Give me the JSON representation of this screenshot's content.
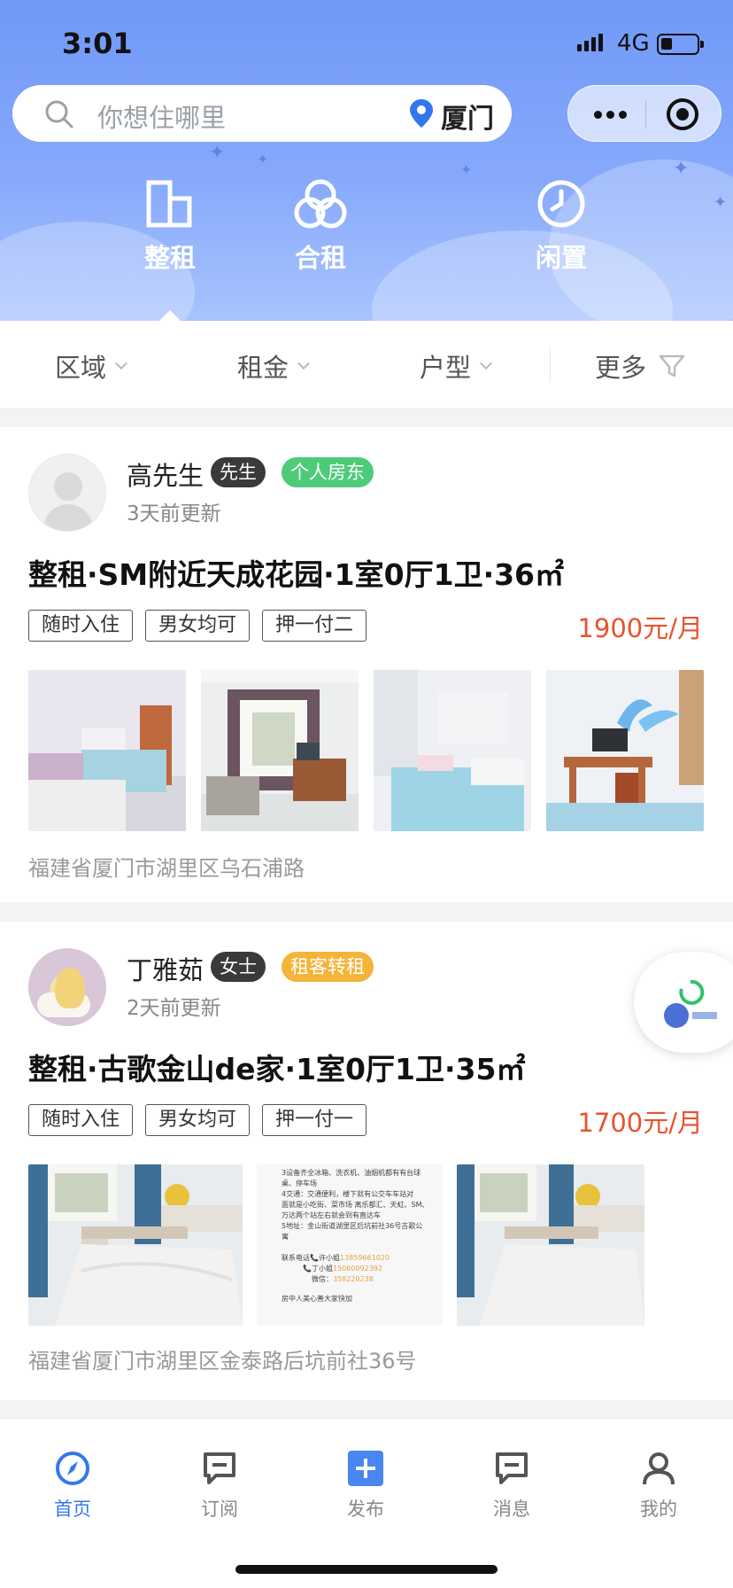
{
  "status": {
    "time": "3:01",
    "network": "4G"
  },
  "search": {
    "placeholder": "你想住哪里",
    "city": "厦门"
  },
  "categories": [
    {
      "label": "整租",
      "icon": "building-icon"
    },
    {
      "label": "合租",
      "icon": "circles-icon"
    },
    {
      "label": "闲置",
      "icon": "clock-icon"
    }
  ],
  "filters": [
    {
      "label": "区域"
    },
    {
      "label": "租金"
    },
    {
      "label": "户型"
    },
    {
      "label": "更多"
    }
  ],
  "listings": [
    {
      "owner": "高先生",
      "gender": "先生",
      "role": "个人房东",
      "updated": "3天前更新",
      "title": "整租·SM附近天成花园·1室0厅1卫·36㎡",
      "tags": [
        "随时入住",
        "男女均可",
        "押一付二"
      ],
      "price": "1900元/月",
      "address": "福建省厦门市湖里区乌石浦路"
    },
    {
      "owner": "丁雅茹",
      "gender": "女士",
      "role": "租客转租",
      "updated": "2天前更新",
      "title": "整租·古歌金山de家·1室0厅1卫·35㎡",
      "tags": [
        "随时入住",
        "男女均可",
        "押一付一"
      ],
      "price": "1700元/月",
      "address": "福建省厦门市湖里区金泰路后坑前社36号",
      "notice": {
        "lines": [
          "3设备齐全冰箱、洗衣机、油烟机都有有台球",
          "桌、停车场",
          "4交通：交通便利，楼下就有公交车车站对",
          "面就是小吃街、菜市场 离乐都汇、天虹、SM、",
          "万达两个站左右就会到有直达车",
          "5地址：金山街道湖里区后坑前社36号古歌公",
          "寓"
        ],
        "contact_label": "联系电话",
        "contacts": [
          {
            "name": "许小姐",
            "phone": "13859661020"
          },
          {
            "name": "丁小姐",
            "phone": "15060092392"
          }
        ],
        "wechat_label": "微信：",
        "wechat": "358220238",
        "footer": "房中人美心善大家快加"
      }
    }
  ],
  "tabbar": [
    {
      "label": "首页",
      "active": true
    },
    {
      "label": "订阅",
      "active": false
    },
    {
      "label": "发布",
      "active": false
    },
    {
      "label": "消息",
      "active": false
    },
    {
      "label": "我的",
      "active": false
    }
  ],
  "colors": {
    "accent": "#3377ee",
    "price": "#e8532e",
    "landlord": "#4ecb79",
    "sublet": "#f4b43a"
  }
}
